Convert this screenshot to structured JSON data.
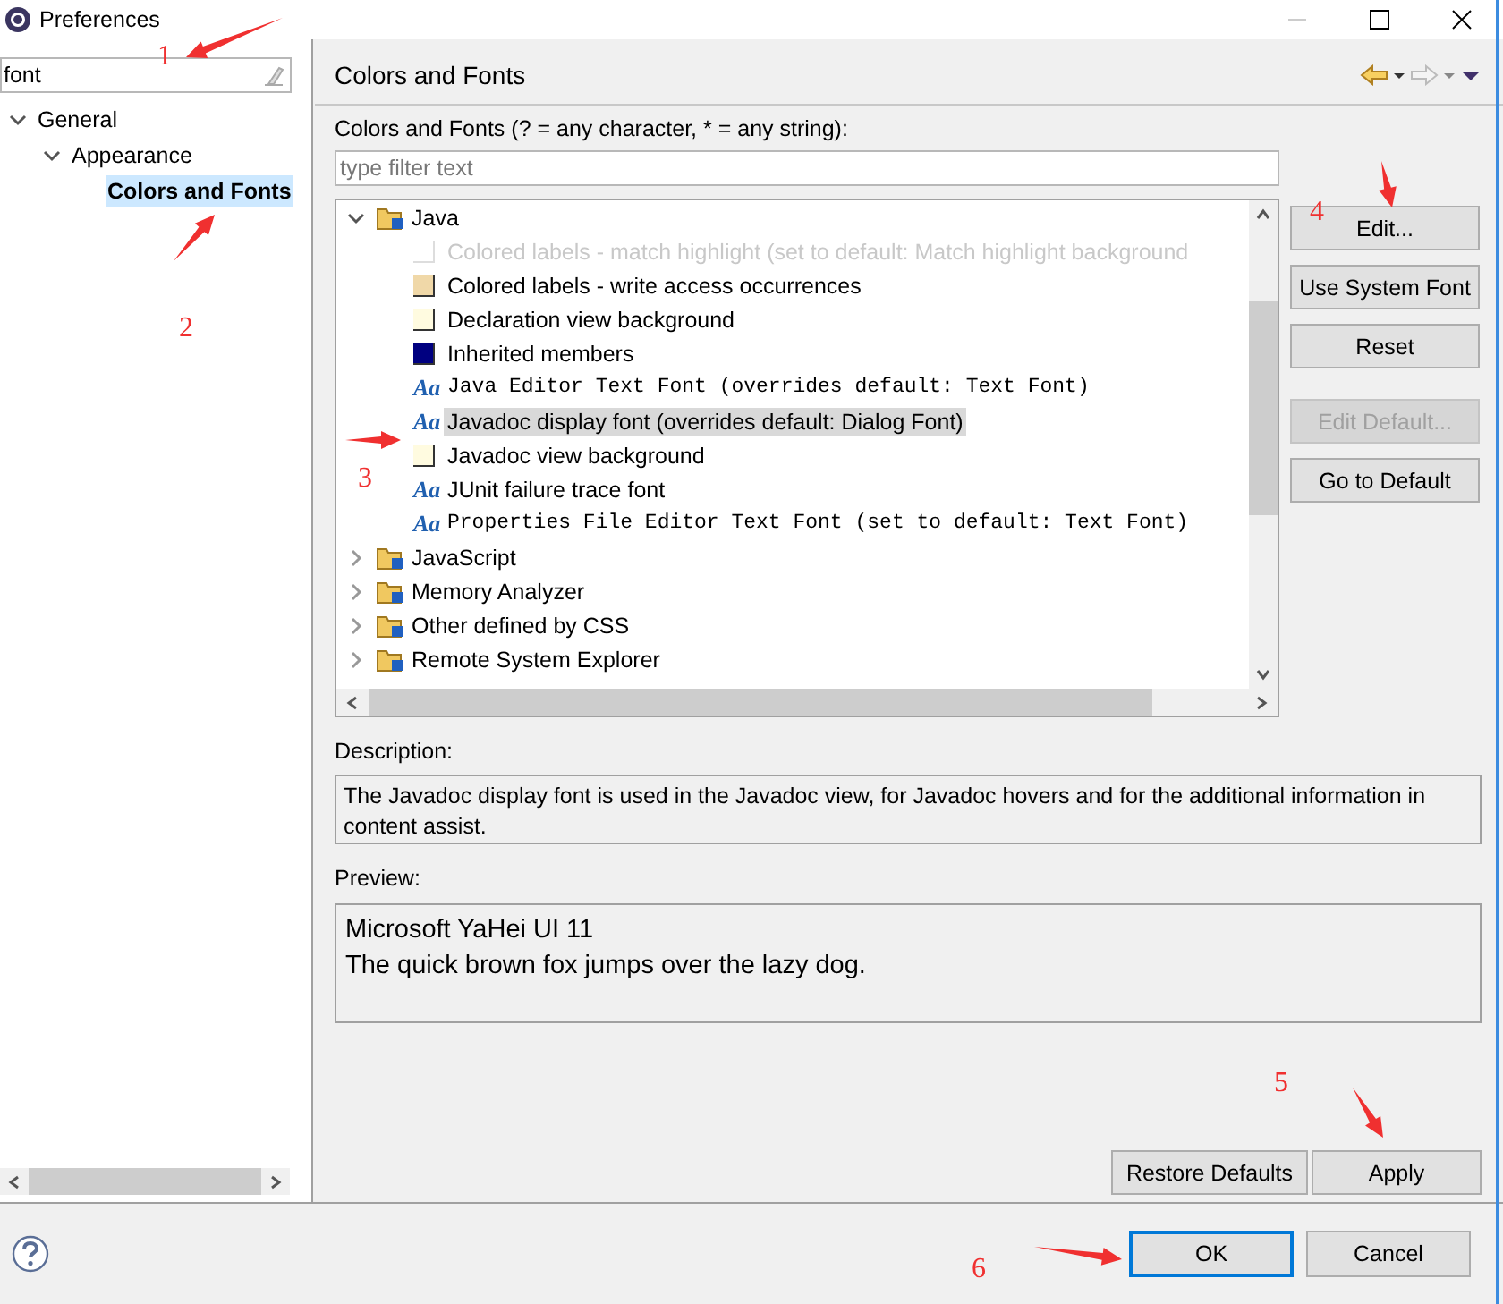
{
  "window": {
    "title": "Preferences"
  },
  "sidebar": {
    "filter": "font",
    "tree": [
      {
        "label": "General",
        "expanded": true,
        "selected": false,
        "children": [
          {
            "label": "Appearance",
            "expanded": true,
            "selected": false,
            "children": [
              {
                "label": "Colors and Fonts",
                "selected": true
              }
            ]
          }
        ]
      }
    ]
  },
  "page": {
    "title": "Colors and Fonts",
    "filter_label": "Colors and Fonts (? = any character, * = any string):",
    "filter_placeholder": "type filter text",
    "tree": [
      {
        "label": "Java",
        "expanded": true,
        "children": [
          {
            "kind": "color",
            "label": "Colored labels - match highlight (set to default: Match highlight background",
            "color": "#ffffff",
            "disabled": true,
            "selected": false
          },
          {
            "kind": "color",
            "label": "Colored labels - write access occurrences",
            "color": "#f0d8a8",
            "disabled": false,
            "selected": false
          },
          {
            "kind": "color",
            "label": "Declaration view background",
            "color": "#fffbe0",
            "disabled": false,
            "selected": false
          },
          {
            "kind": "color",
            "label": "Inherited members",
            "color": "#000080",
            "disabled": false,
            "selected": false
          },
          {
            "kind": "mono_font",
            "icon": "Aa",
            "label": "Java Editor Text Font (overrides default: Text Font)",
            "disabled": false,
            "selected": false
          },
          {
            "kind": "font",
            "icon": "Aa",
            "label": "Javadoc display font (overrides default: Dialog Font)",
            "disabled": false,
            "selected": true
          },
          {
            "kind": "color",
            "label": "Javadoc view background",
            "color": "#fffbe0",
            "disabled": false,
            "selected": false
          },
          {
            "kind": "font",
            "icon": "Aa",
            "label": "JUnit failure trace font",
            "disabled": false,
            "selected": false
          },
          {
            "kind": "mono_font",
            "icon": "Aa",
            "label": "Properties File Editor Text Font (set to default: Text Font)",
            "disabled": false,
            "selected": false
          }
        ]
      },
      {
        "label": "JavaScript",
        "expanded": false
      },
      {
        "label": "Memory Analyzer",
        "expanded": false
      },
      {
        "label": "Other defined by CSS",
        "expanded": false
      },
      {
        "label": "Remote System Explorer",
        "expanded": false
      }
    ],
    "side_buttons": [
      {
        "label": "Edit...",
        "disabled": false
      },
      {
        "label": "Use System Font",
        "disabled": false
      },
      {
        "label": "Reset",
        "disabled": false
      },
      {
        "label": "Edit Default...",
        "disabled": true
      },
      {
        "label": "Go to Default",
        "disabled": false
      }
    ],
    "description_label": "Description:",
    "description": "The Javadoc display font is used in the Javadoc view, for Javadoc hovers and for the additional information in content assist.",
    "preview_label": "Preview:",
    "preview_lines": [
      "Microsoft YaHei UI 11",
      "The quick brown fox jumps over the lazy dog."
    ],
    "page_buttons": [
      "Restore Defaults",
      "Apply"
    ]
  },
  "dialog_buttons": [
    {
      "label": "OK",
      "default": true
    },
    {
      "label": "Cancel",
      "default": false
    }
  ],
  "annotations": [
    {
      "text": "1"
    },
    {
      "text": "2"
    },
    {
      "text": "3"
    },
    {
      "text": "4"
    },
    {
      "text": "5"
    },
    {
      "text": "6"
    }
  ]
}
